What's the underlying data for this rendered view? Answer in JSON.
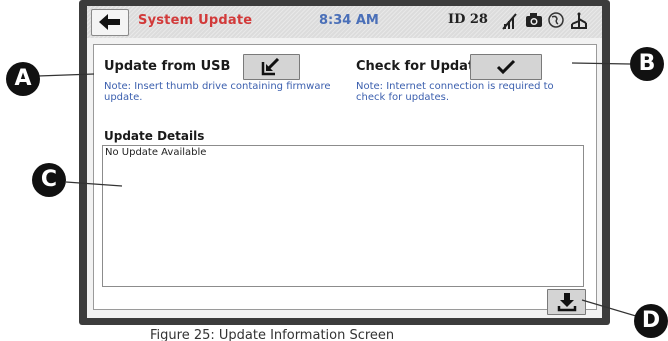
{
  "status_bar": {
    "title": "System Update",
    "time": "8:34 AM",
    "device_id": "ID 28"
  },
  "usb_update": {
    "label": "Update from USB",
    "note": "Note:  Insert thumb drive containing firmware update."
  },
  "check_update": {
    "label": "Check for Update",
    "note": "Note:  Internet connection is required to check for updates."
  },
  "details": {
    "label": "Update Details",
    "content": "No Update Available"
  },
  "callouts": {
    "a": "A",
    "b": "B",
    "c": "C",
    "d": "D"
  },
  "caption": "Figure 25: Update Information Screen",
  "icons": {
    "back": "arrow-left-icon",
    "no_wifi": "wifi-off-icon",
    "camera": "camera-icon",
    "network": "globe-icon",
    "usb": "usb-icon",
    "import": "import-icon",
    "check": "checkmark-icon",
    "download": "download-icon"
  },
  "colors": {
    "title": "#d23a3a",
    "clock": "#4a6fb8",
    "note": "#3b5fae",
    "bezel": "#3c3c3c"
  }
}
